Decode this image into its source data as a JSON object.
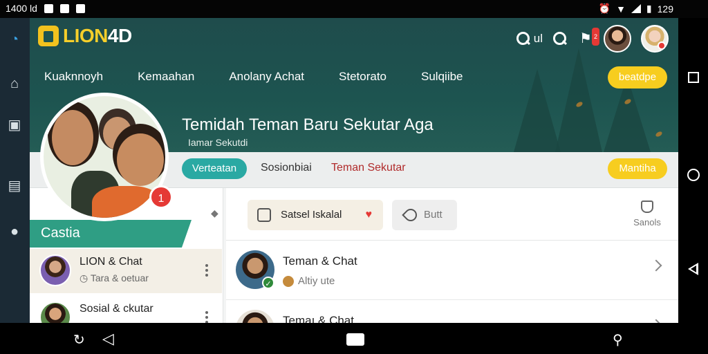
{
  "status_bar": {
    "time": "1400 ld",
    "clock": "129"
  },
  "app": {
    "logo_part1": "LION",
    "logo_part2": "4D",
    "search_label": "ul",
    "notification_badge": "2",
    "menu": [
      "Kuaknnoyh",
      "Kemaahan",
      "Anolany Achat",
      "Stetorato",
      "Sulqiibe"
    ],
    "hero_button": "beatdpe",
    "hero_title": "Temidah Teman Baru Sekutar Aga",
    "hero_subtitle": "Iamar Sekutdi",
    "profile_pin": "1"
  },
  "subtabs": {
    "active": "Verteatan",
    "tab2": "Sosionbiai",
    "tab3": "Teman Sekutar",
    "right_button": "Mantiha"
  },
  "left_panel": {
    "section_label": "Castia",
    "chats": [
      {
        "name": "LION & Chat",
        "sub": "Tara & oetuar"
      },
      {
        "name": "Sosial & ckutar",
        "sub": ""
      }
    ]
  },
  "main_panel": {
    "button1": "Satsel Iskalal",
    "button2": "Butt",
    "right_label": "Sanols",
    "rows": [
      {
        "title": "Teman & Chat",
        "sub": "Altiy ute"
      },
      {
        "title": "Temaı & Chat",
        "sub": ""
      }
    ]
  },
  "colors": {
    "hero": "#1d5450",
    "accent_yellow": "#f7cd1f",
    "accent_teal": "#2aa9a3",
    "section_green": "#2f9e84"
  }
}
